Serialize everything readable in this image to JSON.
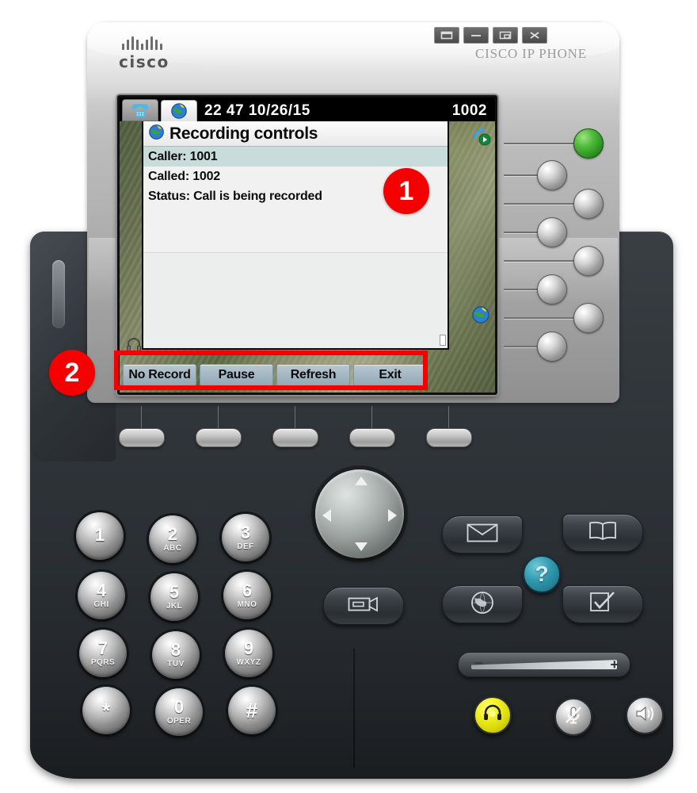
{
  "device": {
    "brand": "cisco",
    "model_label": "CISCO IP PHONE",
    "window_controls": [
      "restore-icon",
      "minimize-icon",
      "maximize-icon",
      "close-icon"
    ]
  },
  "lcd": {
    "status_bar": {
      "tab_phone_icon": "phone-tab-icon",
      "tab_services_icon": "globe-tab-icon",
      "time": "22 47",
      "date": "10/26/15",
      "time_date": "22 47 10/26/15",
      "extension": "1002"
    },
    "app": {
      "title": "Recording controls",
      "title_icon": "globe-icon",
      "rows": [
        {
          "label": "Caller: 1001",
          "selected": true
        },
        {
          "label": "Called: 1002",
          "selected": false
        },
        {
          "label": "Status: Call is being recorded",
          "selected": false
        }
      ]
    },
    "edge_icons": [
      {
        "name": "call-forward-icon",
        "position": "top-right"
      },
      {
        "name": "services-globe-icon",
        "position": "bottom-right"
      },
      {
        "name": "headset-indicator-icon",
        "position": "bottom-left"
      }
    ],
    "softkeys": [
      {
        "label": "No Record"
      },
      {
        "label": "Pause"
      },
      {
        "label": "Refresh"
      },
      {
        "label": "Exit"
      }
    ]
  },
  "line_buttons": [
    {
      "index": 1,
      "state": "active",
      "color": "#3fae2d"
    },
    {
      "index": 2,
      "state": "idle",
      "color": "#c8c8c8"
    },
    {
      "index": 3,
      "state": "idle",
      "color": "#c8c8c8"
    },
    {
      "index": 4,
      "state": "idle",
      "color": "#c8c8c8"
    },
    {
      "index": 5,
      "state": "idle",
      "color": "#c8c8c8"
    },
    {
      "index": 6,
      "state": "idle",
      "color": "#c8c8c8"
    },
    {
      "index": 7,
      "state": "idle",
      "color": "#c8c8c8"
    },
    {
      "index": 8,
      "state": "idle",
      "color": "#c8c8c8"
    }
  ],
  "softkey_hardware": [
    {
      "index": 1
    },
    {
      "index": 2
    },
    {
      "index": 3
    },
    {
      "index": 4
    },
    {
      "index": 5
    }
  ],
  "keypad": [
    {
      "digit": "1",
      "letters": ""
    },
    {
      "digit": "2",
      "letters": "ABC"
    },
    {
      "digit": "3",
      "letters": "DEF"
    },
    {
      "digit": "4",
      "letters": "GHI"
    },
    {
      "digit": "5",
      "letters": "JKL"
    },
    {
      "digit": "6",
      "letters": "MNO"
    },
    {
      "digit": "7",
      "letters": "PQRS"
    },
    {
      "digit": "8",
      "letters": "TUV"
    },
    {
      "digit": "9",
      "letters": "WXYZ"
    },
    {
      "digit": "*",
      "letters": ""
    },
    {
      "digit": "0",
      "letters": "OPER"
    },
    {
      "digit": "#",
      "letters": ""
    }
  ],
  "navigation": {
    "up": "nav-up-arrow-icon",
    "down": "nav-down-arrow-icon",
    "left": "nav-left-arrow-icon",
    "right": "nav-right-arrow-icon"
  },
  "feature_buttons": [
    {
      "name": "messages-button",
      "icon": "envelope-icon"
    },
    {
      "name": "directories-button",
      "icon": "book-icon"
    },
    {
      "name": "video-button",
      "icon": "video-camera-icon"
    },
    {
      "name": "services-button",
      "icon": "globe-icon"
    },
    {
      "name": "settings-button",
      "icon": "checklist-icon"
    },
    {
      "name": "help-button",
      "icon": "question-mark-icon",
      "label": "?"
    }
  ],
  "volume": {
    "minus": "–",
    "plus": "+"
  },
  "audio_buttons": [
    {
      "name": "headset-button",
      "icon": "headset-icon",
      "state": "on",
      "color": "#f2f22b"
    },
    {
      "name": "mute-button",
      "icon": "mute-microphone-icon",
      "state": "off",
      "color": "#c8c8c8"
    },
    {
      "name": "speaker-button",
      "icon": "speaker-icon",
      "state": "off",
      "color": "#c8c8c8"
    }
  ],
  "callouts": [
    {
      "number": "1",
      "target": "recording-controls-panel"
    },
    {
      "number": "2",
      "target": "softkey-strip"
    }
  ]
}
